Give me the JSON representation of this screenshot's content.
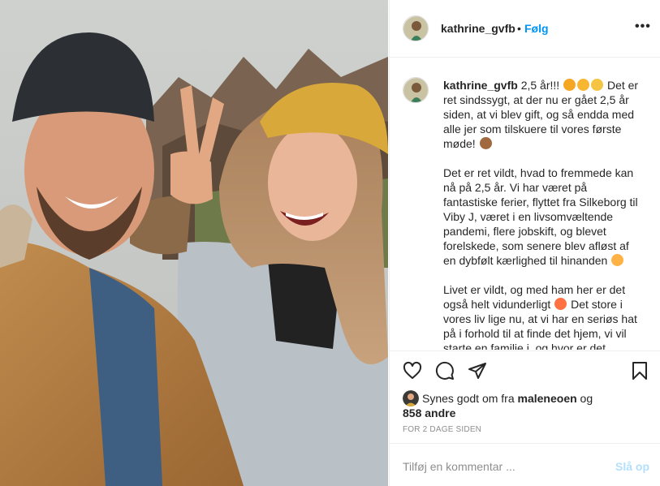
{
  "post": {
    "username": "kathrine_gvfb",
    "separator": "•",
    "follow_label": "Følg",
    "more_label": "•••"
  },
  "caption": {
    "username": "kathrine_gvfb",
    "p1": " 2,5 år!!! ",
    "p1b": " Det er ret sindssygt, at der nu er gået 2,5 år siden, at vi blev gift, og så endda med alle jer som tilskuere til vores første møde! ",
    "p2": "Det er ret vildt, hvad to fremmede kan nå på 2,5 år. Vi har været på fantastiske ferier, flyttet fra Silkeborg til Viby J, været i en livsomvæltende pandemi, flere jobskift, og blevet forelskede, som senere blev afløst af en dybfølt kærlighed til hinanden ",
    "p3": "Livet er vildt, og med ham her er det også helt vidunderligt ",
    "p3b": " Det store i vores liv lige nu, at vi har en seriøs hat på i forhold til at finde det hjem, vi vil starte en familie i, og hvor er det",
    "emoji_colors": [
      "#f5a623",
      "#f7b733",
      "#f4c542",
      "#e9a15a",
      "#ffb347",
      "#ff7043"
    ]
  },
  "actions": {
    "like_icon": "heart-icon",
    "comment_icon": "comment-icon",
    "share_icon": "paper-plane-icon",
    "save_icon": "bookmark-icon"
  },
  "likes": {
    "prefix": "Synes godt om fra ",
    "liker": "maleneoen",
    "middle": " og",
    "others": "858 andre"
  },
  "timestamp": "For 2 dage siden",
  "comment": {
    "placeholder": "Tilføj en kommentar ...",
    "post_label": "Slå op"
  }
}
